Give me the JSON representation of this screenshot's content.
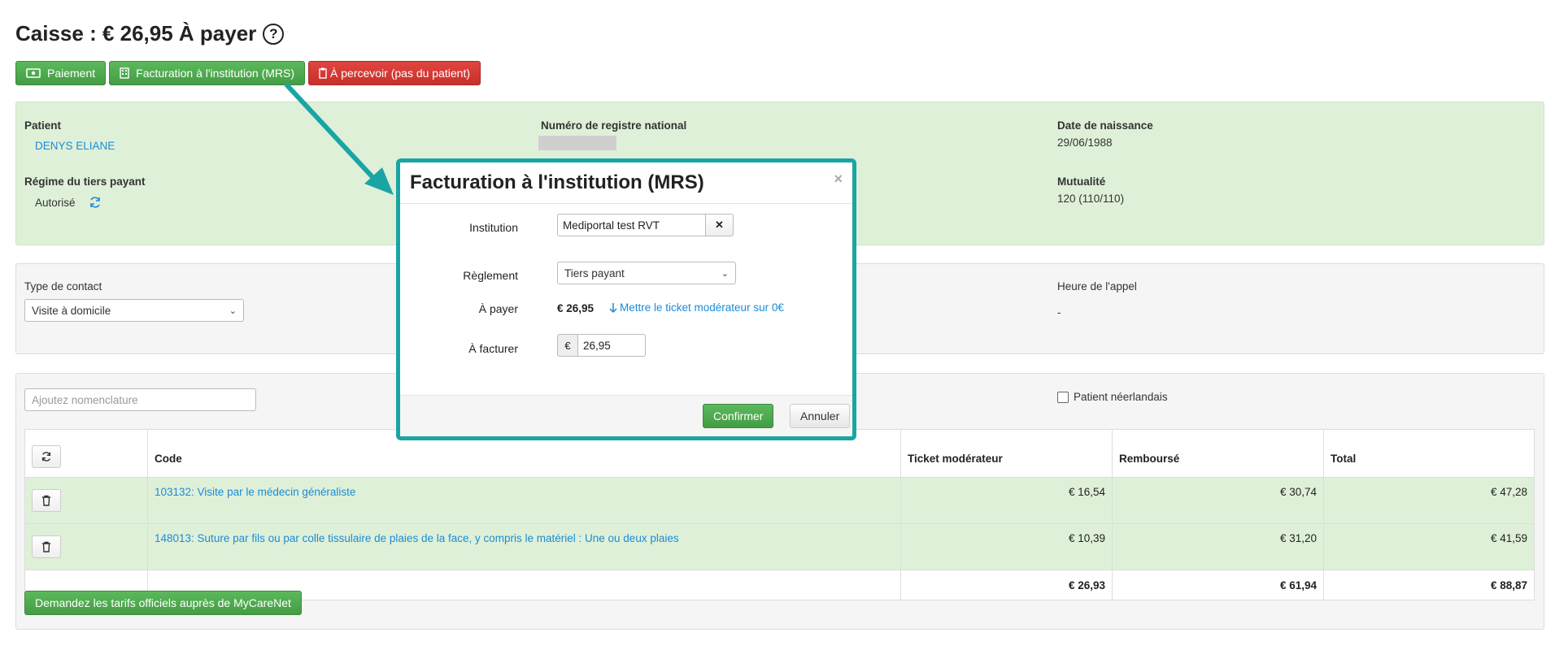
{
  "header": {
    "title": "Caisse : € 26,95 À payer",
    "help_glyph": "?"
  },
  "actions": {
    "paiement": "Paiement",
    "facturation": "Facturation à l'institution (MRS)",
    "percevoir": "À percevoir (pas du patient)"
  },
  "patient": {
    "patient_label": "Patient",
    "patient_name": "DENYS ELIANE",
    "nrn_label": "Numéro de registre national",
    "dob_label": "Date de naissance",
    "dob_value": "29/06/1988",
    "regime_label": "Régime du tiers payant",
    "regime_value": "Autorisé",
    "mutualite_label": "Mutualité",
    "mutualite_value": "120 (110/110)"
  },
  "contact": {
    "type_label": "Type de contact",
    "type_value": "Visite à domicile",
    "heure_label": "Heure de l'appel",
    "heure_value": "-"
  },
  "nomenclature": {
    "placeholder": "Ajoutez nomenclature",
    "dutch_label": "Patient néerlandais",
    "columns": {
      "code": "Code",
      "ticket": "Ticket modérateur",
      "rembourse": "Remboursé",
      "total": "Total"
    },
    "rows": [
      {
        "code": "103132: Visite par le médecin généraliste",
        "ticket": "€ 16,54",
        "rembourse": "€ 30,74",
        "total": "€ 47,28"
      },
      {
        "code": "148013: Suture par fils ou par colle tissulaire de plaies de la face, y compris le matériel : Une ou deux plaies",
        "ticket": "€ 10,39",
        "rembourse": "€ 31,20",
        "total": "€ 41,59"
      }
    ],
    "totals": {
      "ticket": "€ 26,93",
      "rembourse": "€ 61,94",
      "total": "€ 88,87"
    },
    "mycarenet_button": "Demandez les tarifs officiels auprès de MyCareNet"
  },
  "modal": {
    "title": "Facturation à l'institution (MRS)",
    "close": "×",
    "institution_label": "Institution",
    "institution_value": "Mediportal test RVT",
    "clear": "✕",
    "reglement_label": "Règlement",
    "reglement_value": "Tiers payant",
    "apayer_label": "À payer",
    "apayer_value": "€ 26,95",
    "ticket_link": "Mettre le ticket modérateur sur 0€",
    "afacturer_label": "À facturer",
    "currency": "€",
    "afacturer_value": "26,95",
    "confirm": "Confirmer",
    "cancel": "Annuler"
  },
  "colors": {
    "accent": "#1aa5a5",
    "green": "#5cb85c",
    "red": "#d9534f",
    "link": "#1a8cd8"
  }
}
